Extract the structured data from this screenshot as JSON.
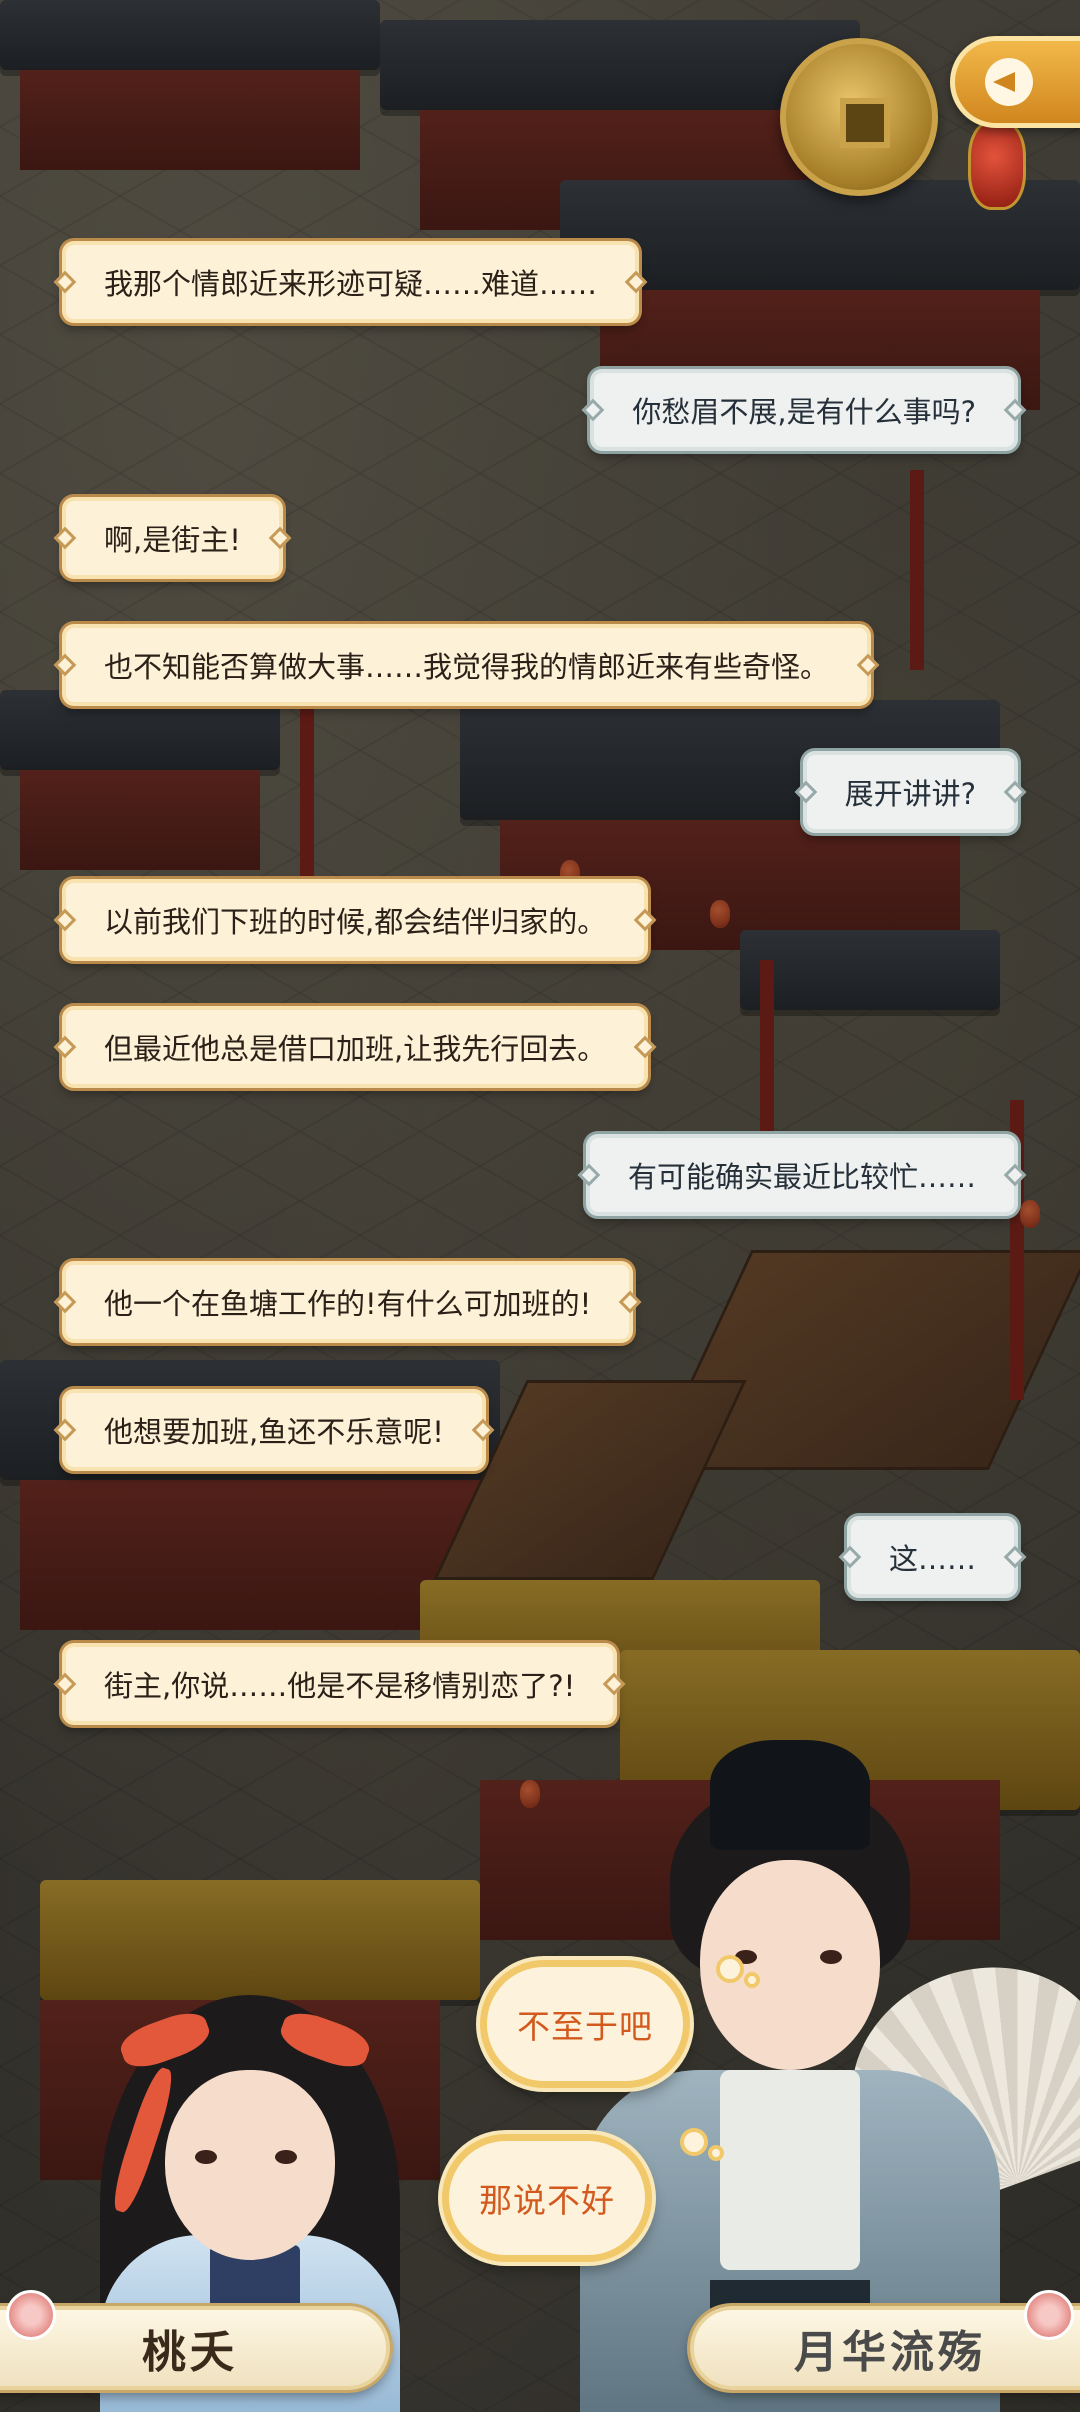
{
  "dialogue": [
    {
      "side": "left",
      "text": "我那个情郎近来形迹可疑……难道……"
    },
    {
      "side": "right",
      "text": "你愁眉不展,是有什么事吗?"
    },
    {
      "side": "left",
      "text": "啊,是街主!"
    },
    {
      "side": "left",
      "text": "也不知能否算做大事……我觉得我的情郎近来有些奇怪。"
    },
    {
      "side": "right",
      "text": "展开讲讲?"
    },
    {
      "side": "left",
      "text": "以前我们下班的时候,都会结伴归家的。"
    },
    {
      "side": "left",
      "text": "但最近他总是借口加班,让我先行回去。"
    },
    {
      "side": "right",
      "text": "有可能确实最近比较忙……"
    },
    {
      "side": "left",
      "text": "他一个在鱼塘工作的!有什么可加班的!"
    },
    {
      "side": "left",
      "text": "他想要加班,鱼还不乐意呢!"
    },
    {
      "side": "right",
      "text": "这……"
    },
    {
      "side": "left",
      "text": "街主,你说……他是不是移情别恋了?!"
    }
  ],
  "choices": {
    "option_1": "不至于吧",
    "option_2": "那说不好"
  },
  "speakers": {
    "left_name": "桃夭",
    "right_name": "月华流殇"
  },
  "colors": {
    "left_bubble_bg": "#fdf2d8",
    "right_bubble_bg": "#eef1ef",
    "choice_text": "#d35a1e",
    "choice_border": "#f2c96a",
    "back_button": "#e8a336"
  },
  "icons": [
    "back-arrow-icon",
    "coin-icon",
    "lantern-icon",
    "plum-blossom-icon"
  ]
}
